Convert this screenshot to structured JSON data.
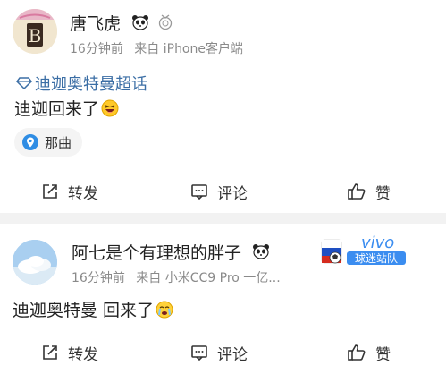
{
  "posts": [
    {
      "username": "唐飞虎",
      "time": "16分钟前",
      "source": "来自 iPhone客户端",
      "topic": "迪迦奥特曼超话",
      "content": "迪迦回来了",
      "location": "那曲",
      "avatar_text": "B",
      "actions": {
        "repost": "转发",
        "comment": "评论",
        "like": "赞"
      }
    },
    {
      "username": "阿七是个有理想的胖子",
      "time": "16分钟前",
      "source": "来自 小米CC9 Pro 一亿...",
      "content": "迪迦奥特曼 回来了",
      "badge": {
        "brand": "vivo",
        "subtitle": "球迷站队"
      },
      "actions": {
        "repost": "转发",
        "comment": "评论",
        "like": "赞"
      }
    }
  ],
  "colors": {
    "topic": "#3b6ea5",
    "vivo": "#3b8df0",
    "divider": "#f2f2f2"
  }
}
